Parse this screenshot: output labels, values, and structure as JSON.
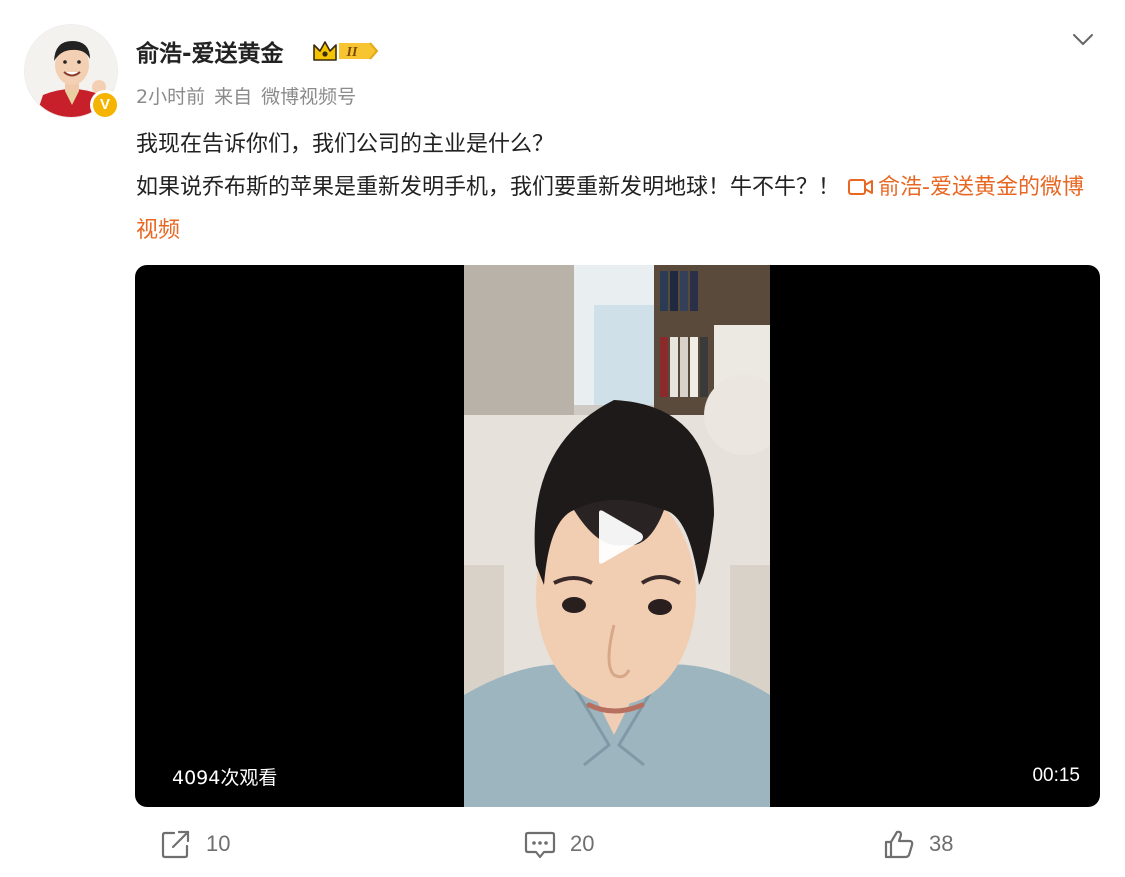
{
  "author": {
    "name": "俞浩-爱送黄金",
    "vip_level": "II",
    "verified_mark": "V"
  },
  "meta": {
    "time": "2小时前",
    "from_label": "来自",
    "source": "微博视频号"
  },
  "post": {
    "line1": "我现在告诉你们，我们公司的主业是什么？",
    "line2": "如果说乔布斯的苹果是重新发明手机，我们要重新发明地球！牛不牛？！",
    "video_link": "俞浩-爱送黄金的微博视频"
  },
  "video": {
    "views": "4094次观看",
    "duration": "00:15"
  },
  "actions": {
    "repost_count": "10",
    "comment_count": "20",
    "like_count": "38"
  },
  "icons": {
    "more": "chevron-down-icon",
    "repost": "share-icon",
    "comment": "comment-icon",
    "like": "thumbs-up-icon",
    "play": "play-icon"
  },
  "colors": {
    "link": "#e86722",
    "meta_gray": "#8b8b8b",
    "vip_gold": "#f5b400"
  }
}
